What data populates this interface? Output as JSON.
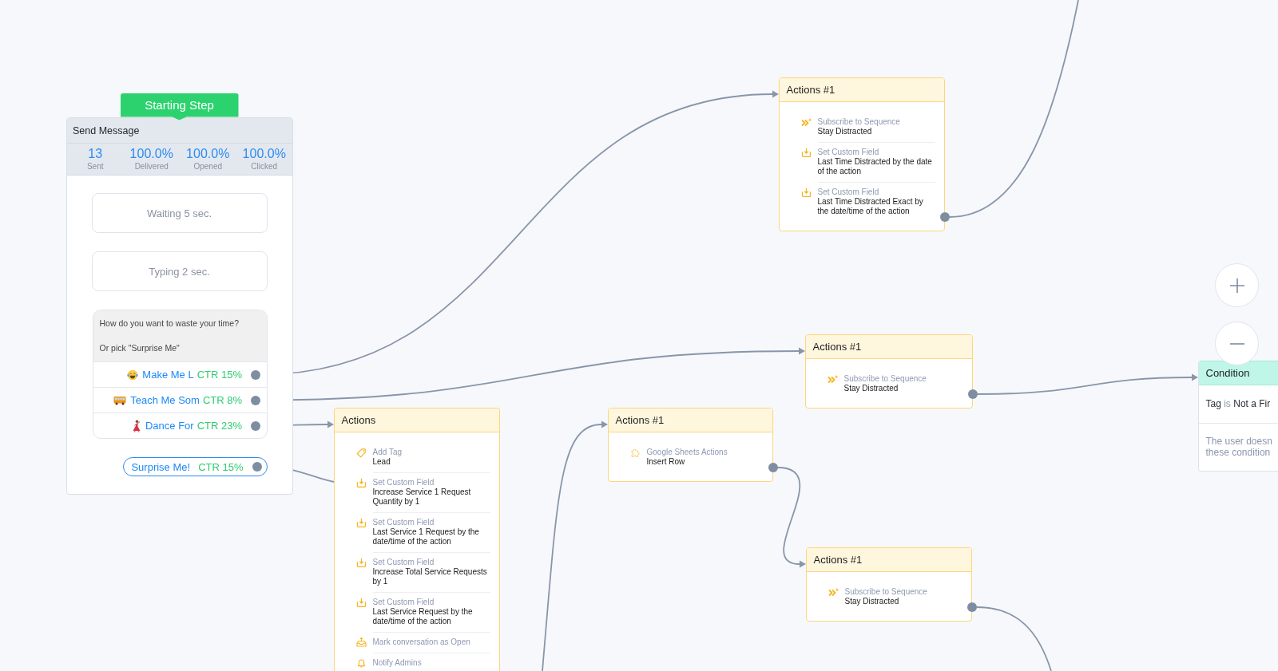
{
  "canvas": {
    "send_message": {
      "badge": "Starting Step",
      "title": "Send Message",
      "stats": [
        {
          "value": "13",
          "label": "Sent"
        },
        {
          "value": "100.0%",
          "label": "Delivered"
        },
        {
          "value": "100.0%",
          "label": "Opened"
        },
        {
          "value": "100.0%",
          "label": "Clicked"
        }
      ],
      "steps": [
        {
          "kind": "delay",
          "text": "Waiting 5 sec."
        },
        {
          "kind": "delay",
          "text": "Typing 2 sec."
        }
      ],
      "message": {
        "lines": [
          "How do you want to waste your time?",
          "Or pick \"Surprise Me\""
        ],
        "buttons": [
          {
            "label": "Make Me L",
            "ctr": "CTR 15%"
          },
          {
            "label": "Teach Me Som",
            "ctr": "CTR 8%"
          },
          {
            "label": "Dance For",
            "ctr": "CTR 23%"
          }
        ]
      },
      "quick_reply": {
        "label": "Surprise Me!",
        "ctr": "CTR 15%"
      }
    },
    "action_nodes": [
      {
        "title": "Actions #1",
        "items": [
          {
            "kind": "sequence",
            "title": "Subscribe to Sequence",
            "detail": "Stay Distracted"
          },
          {
            "kind": "field",
            "title": "Set Custom Field",
            "detail": "Last Time Distracted by the date of the action"
          },
          {
            "kind": "field",
            "title": "Set Custom Field",
            "detail": "Last Time Distracted Exact by the date/time of the action"
          }
        ]
      },
      {
        "title": "Actions #1",
        "items": [
          {
            "kind": "sequence",
            "title": "Subscribe to Sequence",
            "detail": "Stay Distracted"
          }
        ]
      },
      {
        "title": "Actions",
        "items": [
          {
            "kind": "tag",
            "title": "Add Tag",
            "detail": "Lead"
          },
          {
            "kind": "field",
            "title": "Set Custom Field",
            "detail": "Increase Service 1 Request Quantity by 1"
          },
          {
            "kind": "field",
            "title": "Set Custom Field",
            "detail": "Last Service 1 Request by the date/time of the action"
          },
          {
            "kind": "field",
            "title": "Set Custom Field",
            "detail": "Increase Total Service Requests by 1"
          },
          {
            "kind": "field",
            "title": "Set Custom Field",
            "detail": "Last Service Request by the date/time of the action"
          },
          {
            "kind": "conversation",
            "title": "Mark conversation as Open"
          },
          {
            "kind": "notify",
            "title": "Notify Admins"
          }
        ]
      },
      {
        "title": "Actions #1",
        "items": [
          {
            "kind": "integration",
            "title": "Google Sheets Actions",
            "detail": "Insert Row"
          }
        ]
      },
      {
        "title": "Actions #1",
        "items": [
          {
            "kind": "sequence",
            "title": "Subscribe to Sequence",
            "detail": "Stay Distracted"
          }
        ]
      }
    ],
    "condition": {
      "title": "Condition",
      "rule": {
        "field": "Tag",
        "operator": "is",
        "value": "Not a Fir"
      },
      "fallback_lines": [
        "The user doesn",
        "these condition"
      ]
    }
  }
}
